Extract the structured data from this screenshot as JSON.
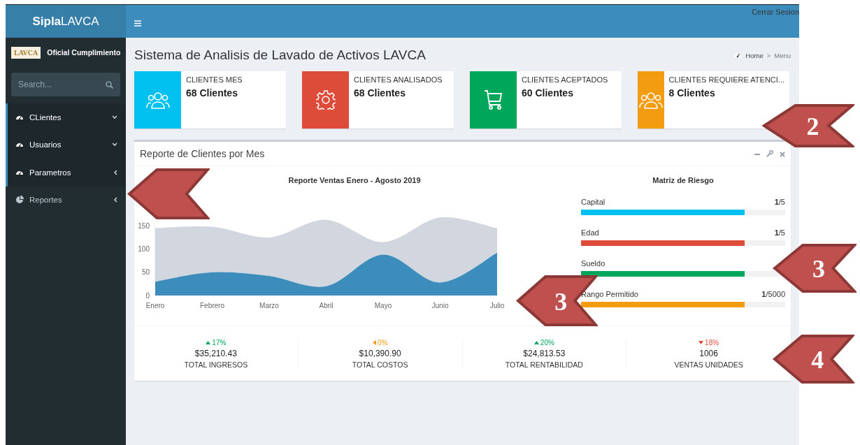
{
  "header": {
    "brand_bold": "Sipla",
    "brand_rest": "LAVCA",
    "logout": "Cerrar Sesion"
  },
  "sidebar": {
    "user": {
      "logo_text": "LAVCA",
      "name": "Oficial Cumplimiento"
    },
    "search": {
      "placeholder": "Search..."
    },
    "items": [
      {
        "label": "CLientes",
        "kind": "gauge",
        "selected": true,
        "expanded": true
      },
      {
        "label": "Usuarios",
        "kind": "gauge",
        "selected": true,
        "expanded": true
      },
      {
        "label": "Parametros",
        "kind": "gauge",
        "selected": true,
        "expanded": false
      },
      {
        "label": "Reportes",
        "kind": "pie",
        "selected": false,
        "expanded": false
      }
    ]
  },
  "page": {
    "title": "Sistema de Analisis de Lavado de Activos LAVCA",
    "breadcrumb": [
      "Home",
      "Menu"
    ],
    "breadcrumb_separator": ">"
  },
  "info_boxes": [
    {
      "label": "CLIENTES MES",
      "value": "68 Clientes",
      "kind": "people",
      "color": "#00c0ef"
    },
    {
      "label": "CLIENTES ANALISADOS",
      "value": "68 Clientes",
      "kind": "gear",
      "color": "#dd4b39"
    },
    {
      "label": "CLIENTES ACEPTADOS",
      "value": "60 Clientes",
      "kind": "cart",
      "color": "#00a65a"
    },
    {
      "label": "CLIENTES REQUIERE ATENCI...",
      "value": "8 Clientes",
      "kind": "people",
      "color": "#f39c12"
    }
  ],
  "report": {
    "title": "Reporte de Clientes por Mes",
    "chart_data": {
      "type": "area",
      "title": "Reporte Ventas Enero - Agosto 2019",
      "categories": [
        "Enero",
        "Febrero",
        "Marzo",
        "Abril",
        "Mayo",
        "Junio",
        "Julio"
      ],
      "ylim": [
        0,
        170
      ],
      "yticks": [
        0,
        50,
        100,
        150
      ],
      "series": [
        {
          "color": "#d2d6de",
          "values": [
            145,
            148,
            125,
            163,
            115,
            168,
            145
          ]
        },
        {
          "color": "#3c8dbc",
          "values": [
            30,
            50,
            42,
            20,
            88,
            28,
            92
          ]
        }
      ]
    },
    "matrix": {
      "title": "Matriz de Riesgo",
      "items": [
        {
          "label": "Capital",
          "value_bold": "1",
          "value_rest": "/5",
          "level": 0.8,
          "color": "#00c0ef"
        },
        {
          "label": "Edad",
          "value_bold": "1",
          "value_rest": "/5",
          "level": 0.8,
          "color": "#dd4b39"
        },
        {
          "label": "Sueldo",
          "level": 0.8,
          "color": "#00a65a"
        },
        {
          "label": "Rango Permitido",
          "value_bold": "1",
          "value_rest": "/5000",
          "level": 0.8,
          "color": "#f39c12"
        }
      ]
    },
    "stats": [
      {
        "change": "17%",
        "kind": "up",
        "amount": "$35,210.43",
        "label": "TOTAL INGRESOS"
      },
      {
        "change": "0%",
        "kind": "flat",
        "amount": "$10,390.90",
        "label": "TOTAL COSTOS"
      },
      {
        "change": "20%",
        "kind": "up",
        "amount": "$24,813.53",
        "label": "TOTAL RENTABILIDAD"
      },
      {
        "change": "18%",
        "kind": "down",
        "amount": "1006",
        "label": "VENTAS UNIDADES"
      }
    ]
  },
  "annotations": [
    {
      "kind": "arrow"
    },
    {
      "kind": "arrow",
      "label": "2"
    },
    {
      "kind": "arrow",
      "label": "3"
    },
    {
      "kind": "arrow",
      "label": "3"
    },
    {
      "kind": "arrow",
      "label": "4"
    }
  ]
}
